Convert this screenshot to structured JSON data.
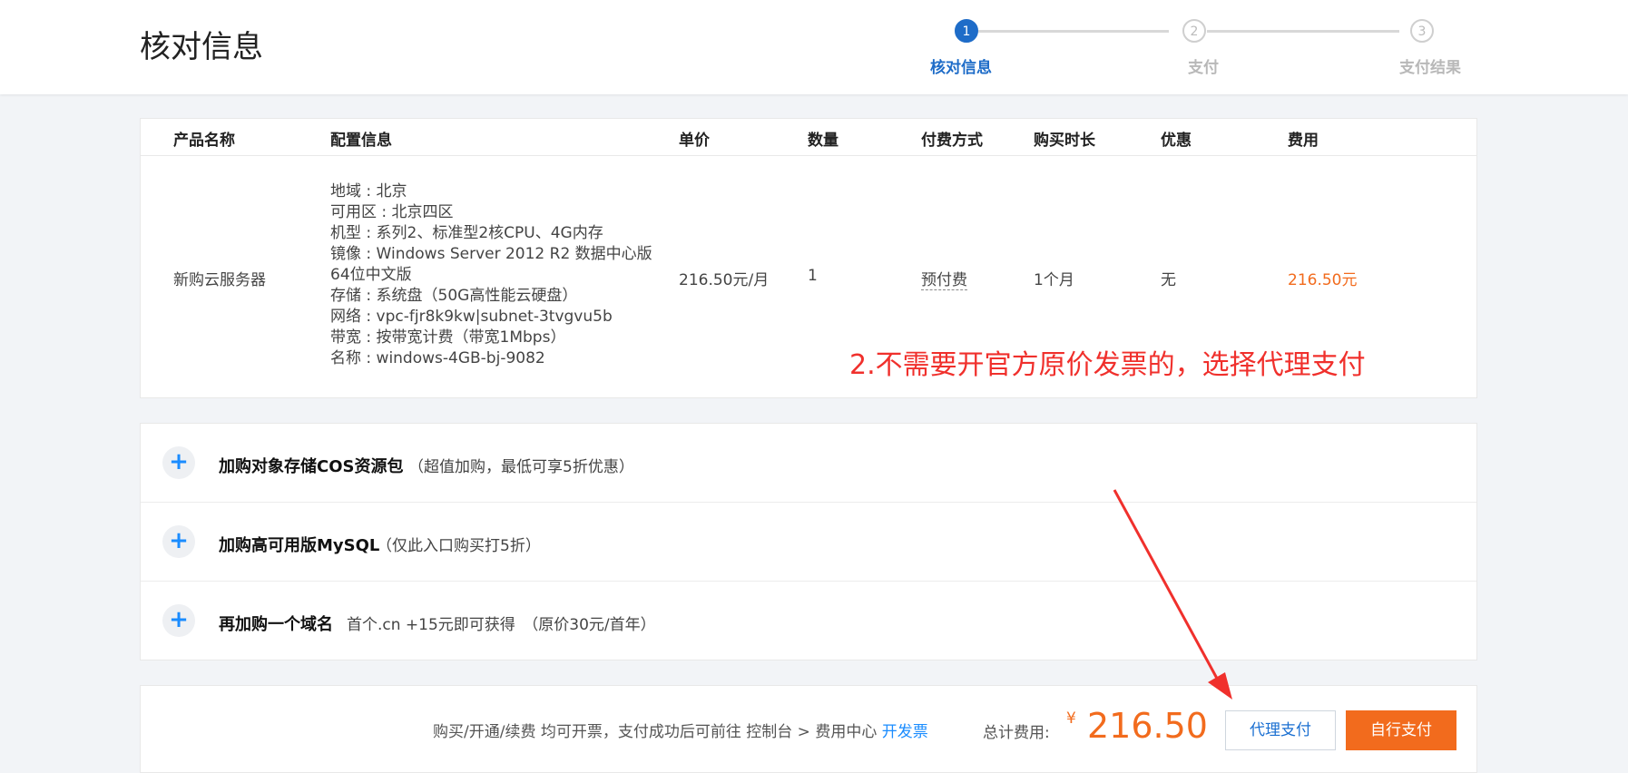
{
  "header": {
    "title": "核对信息",
    "steps": [
      {
        "number": "1",
        "label": "核对信息",
        "state": "active"
      },
      {
        "number": "2",
        "label": "支付",
        "state": "inactive"
      },
      {
        "number": "3",
        "label": "支付结果",
        "state": "inactive"
      }
    ]
  },
  "order": {
    "columns": [
      "产品名称",
      "配置信息",
      "单价",
      "数量",
      "付费方式",
      "购买时长",
      "优惠",
      "费用"
    ],
    "row": {
      "product_name": "新购云服务器",
      "config": [
        "地域 : 北京",
        "可用区 : 北京四区",
        "机型 : 系列2、标准型2核CPU、4G内存",
        "镜像 : Windows Server 2012 R2 数据中心版",
        "64位中文版",
        "存储 : 系统盘（50G高性能云硬盘）",
        "网络 : vpc-fjr8k9kw|subnet-3tvgvu5b",
        "带宽 : 按带宽计费（带宽1Mbps）",
        "名称 : windows-4GB-bj-9082"
      ],
      "unit_price": "216.50元/月",
      "quantity": "1",
      "payment_method": "预付费",
      "duration": "1个月",
      "discount": "无",
      "fee": "216.50元"
    }
  },
  "annotation": "2.不需要开官方原价发票的，选择代理支付",
  "addons": [
    {
      "title": "加购对象存储COS资源包",
      "desc": "（超值加购，最低可享5折优惠）"
    },
    {
      "title": "加购高可用版MySQL",
      "desc": "（仅此入口购买打5折）"
    },
    {
      "title": "再加购一个域名",
      "desc": "首个.cn +15元即可获得　（原价30元/首年）"
    }
  ],
  "footer": {
    "invoice_note": "购买/开通/续费 均可开票，支付成功后可前往 控制台 > 费用中心 ",
    "invoice_link": "开发票",
    "total_label": "总计费用:",
    "currency": "¥",
    "total_amount": "216.50",
    "agent_pay_label": "代理支付",
    "self_pay_label": "自行支付"
  },
  "colors": {
    "primary_blue": "#1e6cc8",
    "link_blue": "#1a8cff",
    "price_orange": "#f26b1d",
    "annotation_red": "#f0302c"
  },
  "icons": {
    "plus": "plus-icon"
  }
}
